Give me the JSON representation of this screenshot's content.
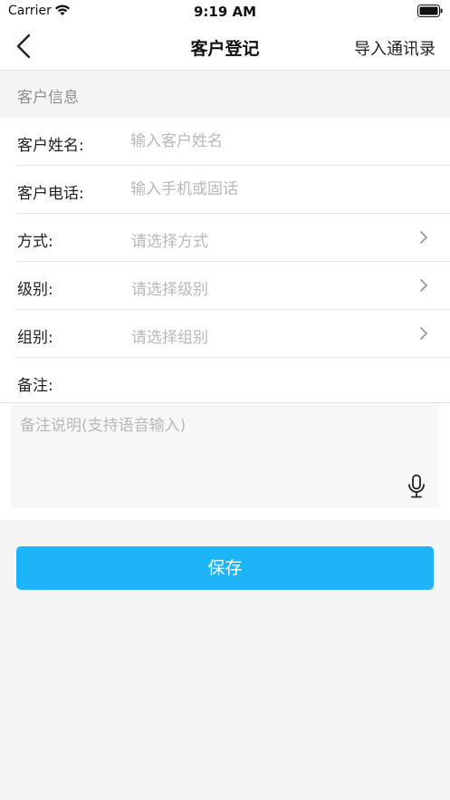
{
  "status_bar": {
    "carrier": "Carrier",
    "time": "9:19 AM"
  },
  "nav": {
    "title": "客户登记",
    "action_label": "导入通讯录",
    "back_icon": "chevron-left-icon"
  },
  "section": {
    "title": "客户信息"
  },
  "form": {
    "name": {
      "label": "客户姓名:",
      "value": "",
      "placeholder": "输入客户姓名"
    },
    "phone": {
      "label": "客户电话:",
      "value": "",
      "placeholder": "输入手机或固话"
    },
    "method": {
      "label": "方式:",
      "placeholder": "请选择方式"
    },
    "level": {
      "label": "级别:",
      "placeholder": "请选择级别"
    },
    "group": {
      "label": "组别:",
      "placeholder": "请选择组别"
    },
    "notes": {
      "label": "备注:",
      "value": "",
      "placeholder": "备注说明(支持语音输入)"
    }
  },
  "save_label": "保存",
  "colors": {
    "accent": "#1eb4f8",
    "background": "#f5f5f5",
    "placeholder": "#b8b8b8"
  }
}
